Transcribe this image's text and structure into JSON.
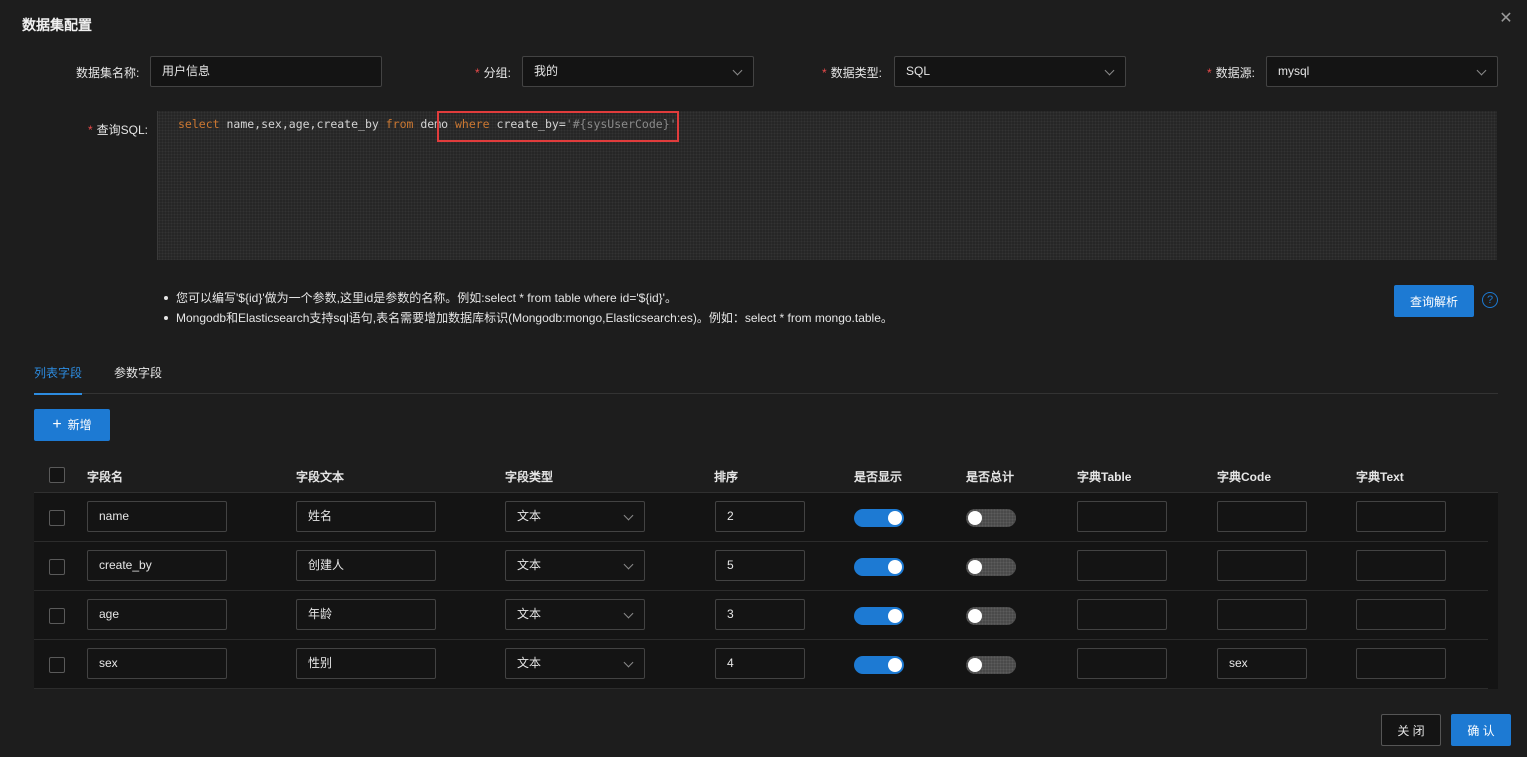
{
  "dialog": {
    "title": "数据集配置"
  },
  "form": {
    "name_label": "数据集名称:",
    "name_value": "用户信息",
    "group_label": "分组:",
    "group_value": "我的",
    "type_label": "数据类型:",
    "type_value": "SQL",
    "source_label": "数据源:",
    "source_value": "mysql",
    "sql_label": "查询SQL:",
    "required_mark": "*"
  },
  "sql": {
    "kw_select": "select",
    "cols": " name,sex,age,create_by ",
    "kw_from": "from",
    "table": " demo ",
    "kw_where": "where",
    "cond": " create_by=",
    "param": "'#{sysUserCode}'"
  },
  "tips": [
    "您可以编写'${id}'做为一个参数,这里id是参数的名称。例如:select * from table where id='${id}'。",
    "Mongodb和Elasticsearch支持sql语句,表名需要增加数据库标识(Mongodb:mongo,Elasticsearch:es)。例如：select * from mongo.table。"
  ],
  "buttons": {
    "parse": "查询解析",
    "help": "?",
    "add": "新增",
    "add_icon": "+",
    "close": "关 闭",
    "confirm": "确 认"
  },
  "tabs": [
    {
      "label": "列表字段",
      "active": true
    },
    {
      "label": "参数字段",
      "active": false
    }
  ],
  "table": {
    "headers": [
      "字段名",
      "字段文本",
      "字段类型",
      "排序",
      "是否显示",
      "是否总计",
      "字典Table",
      "字典Code",
      "字典Text"
    ],
    "rows": [
      {
        "field": "name",
        "text": "姓名",
        "type": "文本",
        "order": "2",
        "show": true,
        "total": false,
        "dict_table": "",
        "dict_code": "",
        "dict_text": ""
      },
      {
        "field": "create_by",
        "text": "创建人",
        "type": "文本",
        "order": "5",
        "show": true,
        "total": false,
        "dict_table": "",
        "dict_code": "",
        "dict_text": ""
      },
      {
        "field": "age",
        "text": "年龄",
        "type": "文本",
        "order": "3",
        "show": true,
        "total": false,
        "dict_table": "",
        "dict_code": "",
        "dict_text": ""
      },
      {
        "field": "sex",
        "text": "性别",
        "type": "文本",
        "order": "4",
        "show": true,
        "total": false,
        "dict_table": "",
        "dict_code": "sex",
        "dict_text": ""
      }
    ]
  },
  "colors": {
    "accent": "#1d7ad3",
    "required": "#e84a4a",
    "highlight_box": "#e03c3c"
  }
}
